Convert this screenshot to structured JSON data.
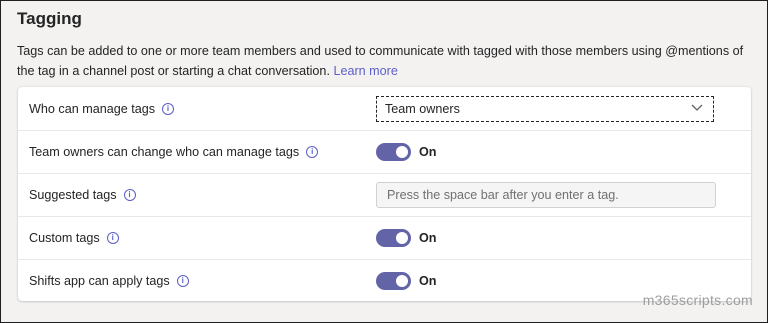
{
  "section": {
    "title": "Tagging",
    "description": "Tags can be added to one or more team members and used to communicate with tagged with those members using @mentions of the tag in a channel post or starting a chat conversation.",
    "learn_more": "Learn more"
  },
  "settings": [
    {
      "label": "Who can manage tags",
      "control": "dropdown",
      "value": "Team owners",
      "icon": "chevron-down-icon"
    },
    {
      "label": "Team owners can change who can manage tags",
      "control": "toggle",
      "state": "On",
      "on": true
    },
    {
      "label": "Suggested tags",
      "control": "text-input",
      "placeholder": "Press the space bar after you enter a tag."
    },
    {
      "label": "Custom tags",
      "control": "toggle",
      "state": "On",
      "on": true
    },
    {
      "label": "Shifts app can apply tags",
      "control": "toggle",
      "state": "On",
      "on": true
    }
  ],
  "info_icon_glyph": "i",
  "colors": {
    "accent": "#6264a7",
    "link": "#5b5fc7"
  },
  "watermark": "m365scripts.com"
}
